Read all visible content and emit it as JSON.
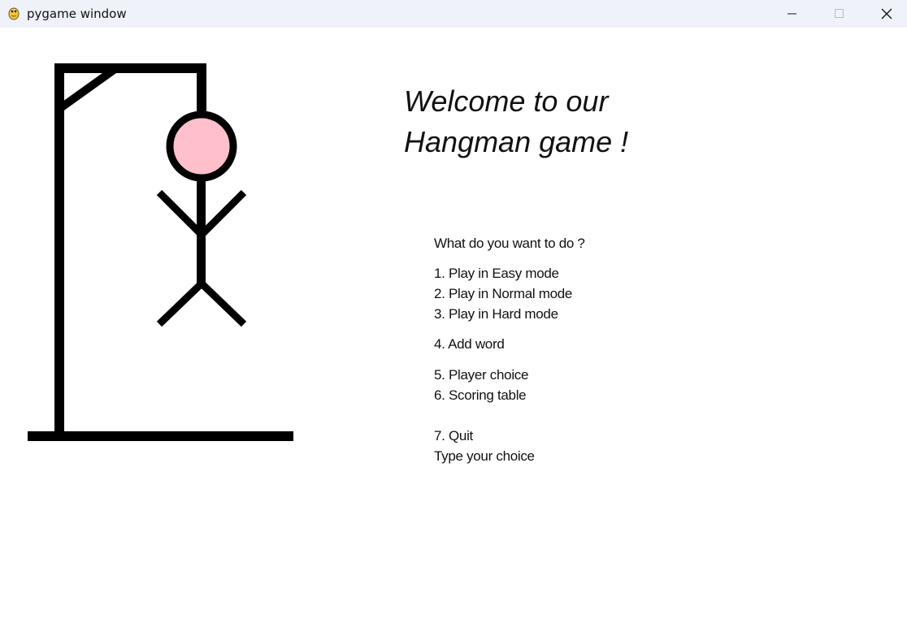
{
  "window": {
    "title": "pygame window",
    "app_icon": "pygame-snake-icon",
    "controls": [
      "minimize-icon",
      "maximize-icon",
      "close-icon"
    ]
  },
  "welcome": {
    "line1": "Welcome to our",
    "line2": "Hangman game !"
  },
  "menu": {
    "prompt": "What do you want to do ?",
    "options": [
      "1. Play in Easy mode",
      "2. Play in Normal mode",
      "3. Play in Hard mode",
      "4. Add word",
      "5. Player choice",
      "6. Scoring table",
      "7. Quit"
    ],
    "input_prompt": "Type your choice"
  },
  "colors": {
    "titlebar": "#eff2f9",
    "gallows": "#000000",
    "head_fill": "#ffc0cb",
    "background": "#ffffff"
  }
}
